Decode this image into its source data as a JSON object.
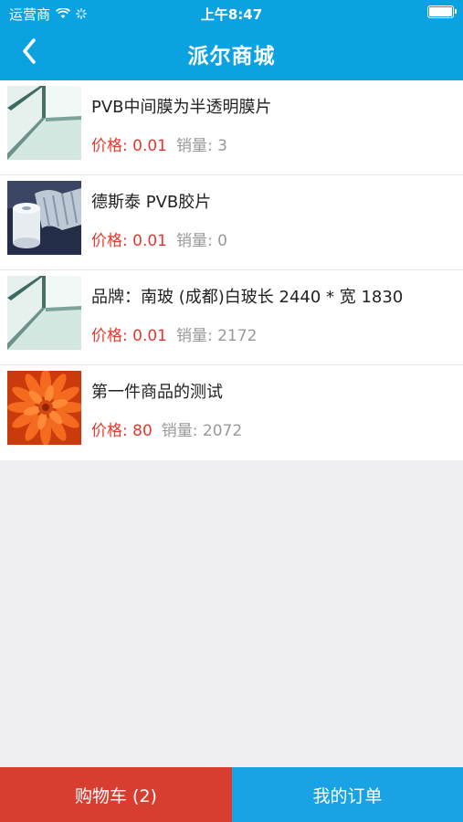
{
  "status_bar": {
    "carrier": "运营商",
    "time": "上午8:47"
  },
  "nav": {
    "title": "派尔商城",
    "back_icon": "chevron-left-icon"
  },
  "products": [
    {
      "title": "PVB中间膜为半透明膜片",
      "price": "价格: 0.01",
      "sales": "销量: 3",
      "image": "glass-corner"
    },
    {
      "title": "德斯泰 PVB胶片",
      "price": "价格: 0.01",
      "sales": "销量: 0",
      "image": "pvb-film-roll"
    },
    {
      "title": "品牌：南玻 (成都)白玻长 2440 * 宽 1830",
      "price": "价格: 0.01",
      "sales": "销量: 2172",
      "image": "glass-corner"
    },
    {
      "title": "第一件商品的测试",
      "price": "价格: 80",
      "sales": "销量: 2072",
      "image": "orange-flower"
    }
  ],
  "tabs": {
    "cart_label": "购物车 (2)",
    "orders_label": "我的订单"
  },
  "colors": {
    "header": "#0ba2e1",
    "price": "#e8382c",
    "cart_tab": "#d83e30",
    "orders_tab": "#1aa3e4",
    "background": "#efeff4"
  }
}
